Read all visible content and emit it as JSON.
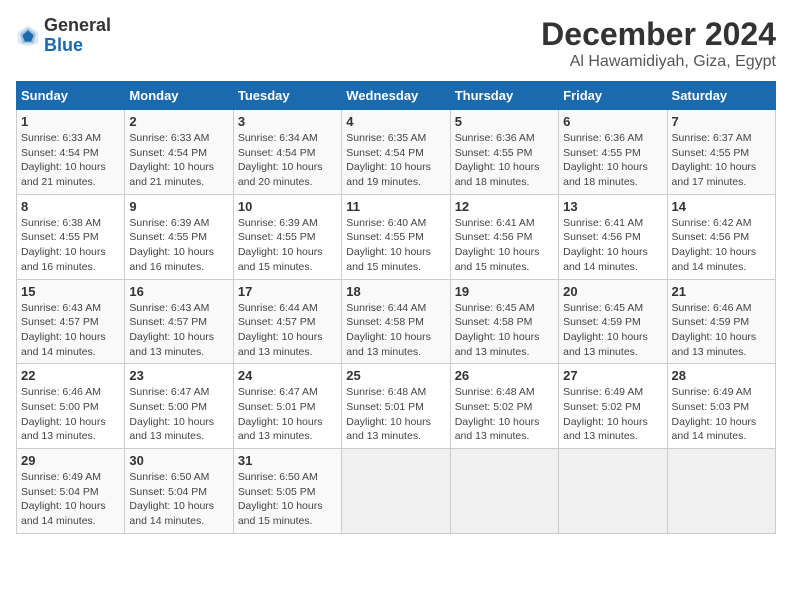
{
  "header": {
    "logo_line1": "General",
    "logo_line2": "Blue",
    "title": "December 2024",
    "subtitle": "Al Hawamidiyah, Giza, Egypt"
  },
  "columns": [
    "Sunday",
    "Monday",
    "Tuesday",
    "Wednesday",
    "Thursday",
    "Friday",
    "Saturday"
  ],
  "weeks": [
    [
      {
        "day": "1",
        "info": "Sunrise: 6:33 AM\nSunset: 4:54 PM\nDaylight: 10 hours\nand 21 minutes."
      },
      {
        "day": "2",
        "info": "Sunrise: 6:33 AM\nSunset: 4:54 PM\nDaylight: 10 hours\nand 21 minutes."
      },
      {
        "day": "3",
        "info": "Sunrise: 6:34 AM\nSunset: 4:54 PM\nDaylight: 10 hours\nand 20 minutes."
      },
      {
        "day": "4",
        "info": "Sunrise: 6:35 AM\nSunset: 4:54 PM\nDaylight: 10 hours\nand 19 minutes."
      },
      {
        "day": "5",
        "info": "Sunrise: 6:36 AM\nSunset: 4:55 PM\nDaylight: 10 hours\nand 18 minutes."
      },
      {
        "day": "6",
        "info": "Sunrise: 6:36 AM\nSunset: 4:55 PM\nDaylight: 10 hours\nand 18 minutes."
      },
      {
        "day": "7",
        "info": "Sunrise: 6:37 AM\nSunset: 4:55 PM\nDaylight: 10 hours\nand 17 minutes."
      }
    ],
    [
      {
        "day": "8",
        "info": "Sunrise: 6:38 AM\nSunset: 4:55 PM\nDaylight: 10 hours\nand 16 minutes."
      },
      {
        "day": "9",
        "info": "Sunrise: 6:39 AM\nSunset: 4:55 PM\nDaylight: 10 hours\nand 16 minutes."
      },
      {
        "day": "10",
        "info": "Sunrise: 6:39 AM\nSunset: 4:55 PM\nDaylight: 10 hours\nand 15 minutes."
      },
      {
        "day": "11",
        "info": "Sunrise: 6:40 AM\nSunset: 4:55 PM\nDaylight: 10 hours\nand 15 minutes."
      },
      {
        "day": "12",
        "info": "Sunrise: 6:41 AM\nSunset: 4:56 PM\nDaylight: 10 hours\nand 15 minutes."
      },
      {
        "day": "13",
        "info": "Sunrise: 6:41 AM\nSunset: 4:56 PM\nDaylight: 10 hours\nand 14 minutes."
      },
      {
        "day": "14",
        "info": "Sunrise: 6:42 AM\nSunset: 4:56 PM\nDaylight: 10 hours\nand 14 minutes."
      }
    ],
    [
      {
        "day": "15",
        "info": "Sunrise: 6:43 AM\nSunset: 4:57 PM\nDaylight: 10 hours\nand 14 minutes."
      },
      {
        "day": "16",
        "info": "Sunrise: 6:43 AM\nSunset: 4:57 PM\nDaylight: 10 hours\nand 13 minutes."
      },
      {
        "day": "17",
        "info": "Sunrise: 6:44 AM\nSunset: 4:57 PM\nDaylight: 10 hours\nand 13 minutes."
      },
      {
        "day": "18",
        "info": "Sunrise: 6:44 AM\nSunset: 4:58 PM\nDaylight: 10 hours\nand 13 minutes."
      },
      {
        "day": "19",
        "info": "Sunrise: 6:45 AM\nSunset: 4:58 PM\nDaylight: 10 hours\nand 13 minutes."
      },
      {
        "day": "20",
        "info": "Sunrise: 6:45 AM\nSunset: 4:59 PM\nDaylight: 10 hours\nand 13 minutes."
      },
      {
        "day": "21",
        "info": "Sunrise: 6:46 AM\nSunset: 4:59 PM\nDaylight: 10 hours\nand 13 minutes."
      }
    ],
    [
      {
        "day": "22",
        "info": "Sunrise: 6:46 AM\nSunset: 5:00 PM\nDaylight: 10 hours\nand 13 minutes."
      },
      {
        "day": "23",
        "info": "Sunrise: 6:47 AM\nSunset: 5:00 PM\nDaylight: 10 hours\nand 13 minutes."
      },
      {
        "day": "24",
        "info": "Sunrise: 6:47 AM\nSunset: 5:01 PM\nDaylight: 10 hours\nand 13 minutes."
      },
      {
        "day": "25",
        "info": "Sunrise: 6:48 AM\nSunset: 5:01 PM\nDaylight: 10 hours\nand 13 minutes."
      },
      {
        "day": "26",
        "info": "Sunrise: 6:48 AM\nSunset: 5:02 PM\nDaylight: 10 hours\nand 13 minutes."
      },
      {
        "day": "27",
        "info": "Sunrise: 6:49 AM\nSunset: 5:02 PM\nDaylight: 10 hours\nand 13 minutes."
      },
      {
        "day": "28",
        "info": "Sunrise: 6:49 AM\nSunset: 5:03 PM\nDaylight: 10 hours\nand 14 minutes."
      }
    ],
    [
      {
        "day": "29",
        "info": "Sunrise: 6:49 AM\nSunset: 5:04 PM\nDaylight: 10 hours\nand 14 minutes."
      },
      {
        "day": "30",
        "info": "Sunrise: 6:50 AM\nSunset: 5:04 PM\nDaylight: 10 hours\nand 14 minutes."
      },
      {
        "day": "31",
        "info": "Sunrise: 6:50 AM\nSunset: 5:05 PM\nDaylight: 10 hours\nand 15 minutes."
      },
      {
        "day": "",
        "info": ""
      },
      {
        "day": "",
        "info": ""
      },
      {
        "day": "",
        "info": ""
      },
      {
        "day": "",
        "info": ""
      }
    ]
  ]
}
